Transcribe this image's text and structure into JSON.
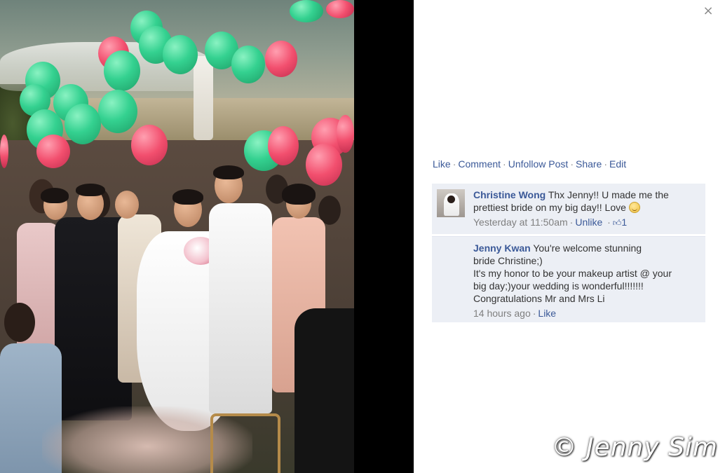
{
  "photo": {
    "alt_icon": "wedding-photo",
    "palette": {
      "green_balloon": "#34d190",
      "pink_balloon": "#f24f6e"
    }
  },
  "panel": {
    "close_glyph": "×",
    "actions": [
      {
        "label": "Like"
      },
      {
        "label": "Comment"
      },
      {
        "label": "Unfollow Post"
      },
      {
        "label": "Share"
      },
      {
        "label": "Edit"
      }
    ],
    "action_separator": "·"
  },
  "comments": [
    {
      "author": "Christine Wong",
      "text": "Thx Jenny!! U made me the prettiest bride on my big day!! Love",
      "emoji": "smile-emoji",
      "time": "Yesterday at 11:50am",
      "unlike_label": "Unlike",
      "like_count": "1"
    },
    {
      "author": "Jenny Kwan",
      "text_line1": "You're welcome stunning",
      "text_line2": "bride Christine;)",
      "text_line3": "It's my honor to be your makeup artist @ your",
      "text_line4": "big day;)your wedding is wonderful!!!!!!!",
      "text_line5": "Congratulations Mr and Mrs Li",
      "time": "14 hours ago",
      "like_label": "Like"
    }
  ],
  "watermark": "© Jenny Sim",
  "colors": {
    "link": "#3b5998",
    "comment_bg": "#eceff5",
    "meta": "#7f7f7f"
  }
}
